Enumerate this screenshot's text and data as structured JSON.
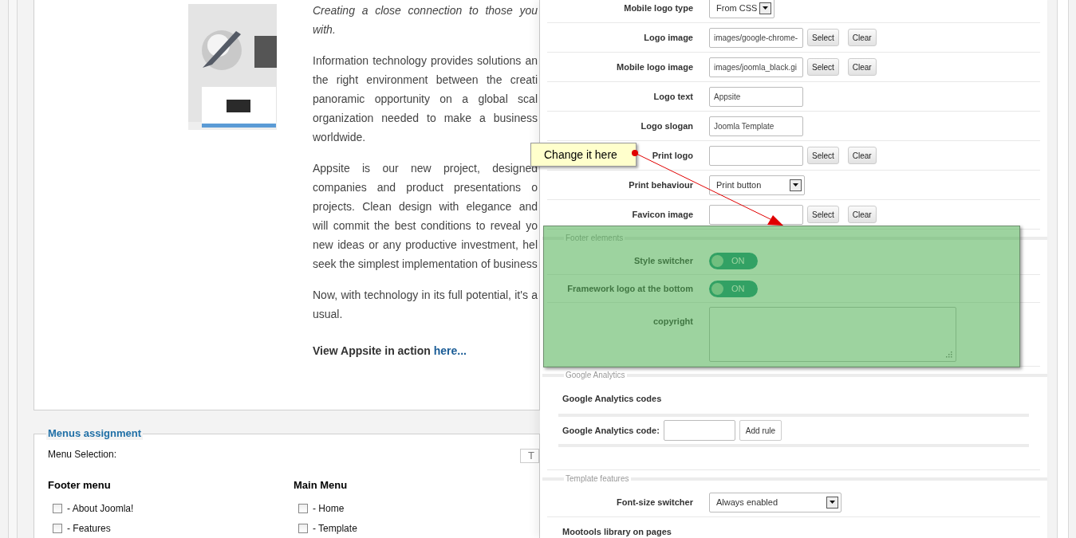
{
  "article": {
    "paragraphs": [
      {
        "lines": [
          "Creating a close connection to those you",
          "with."
        ]
      },
      {
        "lines": [
          "Information technology provides solutions an",
          "the right environment between the creati",
          "panoramic opportunity on a global scal",
          "organization needed to make a business",
          "worldwide."
        ]
      },
      {
        "lines": [
          "Appsite is our new project, designed",
          "companies and product presentations o",
          "projects. Clean design with elegance and",
          "will commit the best conditions to reveal yo",
          "new ideas or any productive investment, hel",
          "seek the simplest implementation of business"
        ]
      },
      {
        "lines": [
          "Now, with technology in its full potential, it's a",
          "usual."
        ]
      }
    ],
    "cta": {
      "text": "View Appsite in action ",
      "link": "here..."
    }
  },
  "menus_assignment": {
    "legend": "Menus assignment",
    "selection_label": "Menu Selection:",
    "toggle_button": "T",
    "menus": [
      {
        "title": "Footer menu",
        "items": [
          {
            "label": "- About Joomla!",
            "checked": false
          },
          {
            "label": "- Features",
            "checked": false
          }
        ]
      },
      {
        "title": "Main Menu",
        "items": [
          {
            "label": "- Home",
            "checked": false
          },
          {
            "label": "- Template",
            "checked": false
          }
        ]
      }
    ]
  },
  "settings": {
    "sections": [
      {
        "rows": [
          {
            "kind": "select",
            "label": "Mobile logo type",
            "value": "From CSS"
          },
          {
            "kind": "file",
            "label": "Logo image",
            "value": "images/google-chrome-",
            "buttons": [
              "Select",
              "Clear"
            ]
          },
          {
            "kind": "file",
            "label": "Mobile logo image",
            "value": "images/joomla_black.gi",
            "buttons": [
              "Select",
              "Clear"
            ]
          },
          {
            "kind": "text",
            "label": "Logo text",
            "value": "Appsite"
          },
          {
            "kind": "text",
            "label": "Logo slogan",
            "value": "Joomla Template"
          },
          {
            "kind": "file",
            "label": "Print logo",
            "buttons": [
              "Select",
              "Clear"
            ]
          },
          {
            "kind": "select",
            "label": "Print behaviour",
            "value": "Print button"
          },
          {
            "kind": "file",
            "label": "Favicon image",
            "buttons": [
              "Select",
              "Clear"
            ]
          }
        ]
      },
      {
        "legend": "Footer elements",
        "rows": [
          {
            "kind": "toggle",
            "label": "Style switcher",
            "on": true,
            "text": "ON"
          },
          {
            "kind": "toggle",
            "label": "Framework logo at the bottom",
            "on": true,
            "text": "ON"
          },
          {
            "kind": "textarea",
            "label": "copyright"
          }
        ]
      },
      {
        "legend": "Google Analytics",
        "rows": [
          {
            "kind": "heading",
            "text": "Google Analytics codes"
          },
          {
            "kind": "code_rule",
            "label": "Google Analytics code:",
            "button": "Add rule"
          }
        ]
      },
      {
        "legend": "Template features",
        "rows": [
          {
            "kind": "select",
            "label": "Font-size switcher",
            "value": "Always enabled"
          },
          {
            "kind": "heading",
            "text": "Mootools library on pages"
          }
        ]
      }
    ]
  },
  "callout": {
    "text": "Change it here"
  }
}
